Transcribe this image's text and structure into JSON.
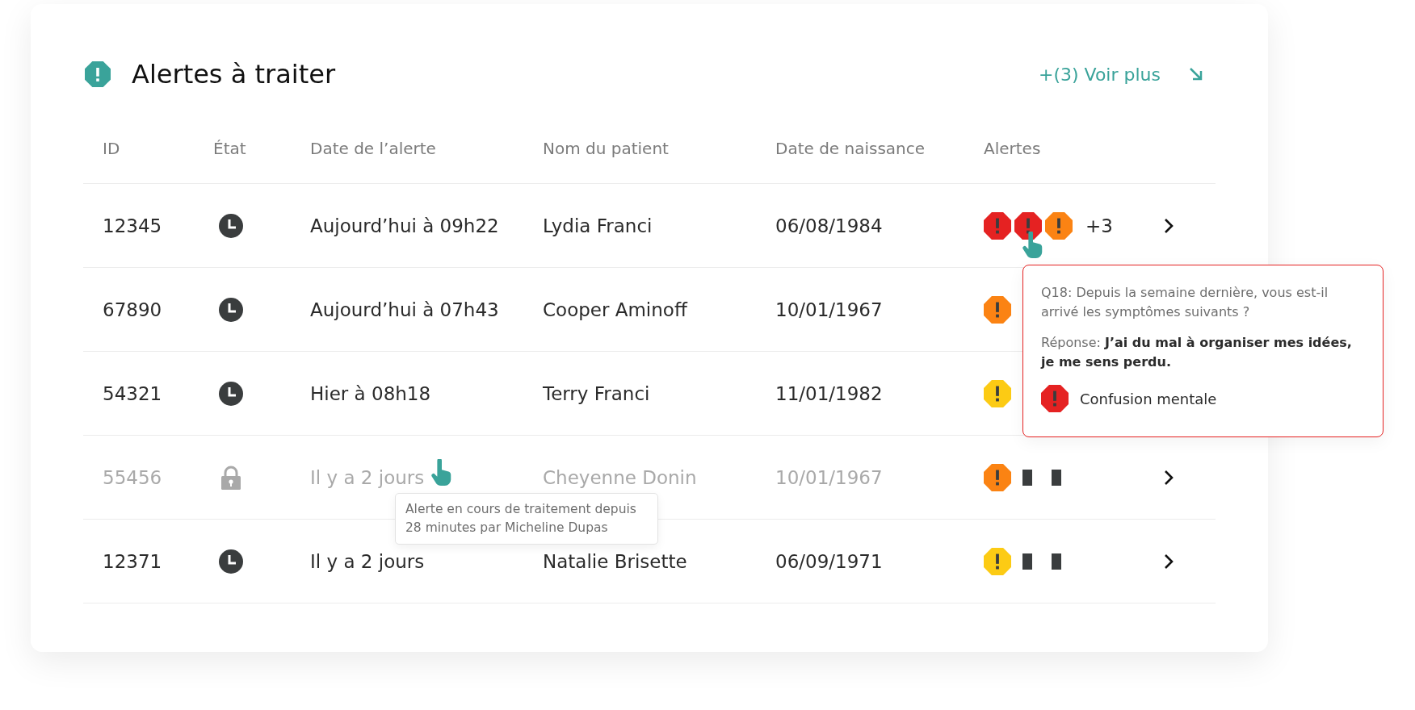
{
  "header": {
    "title": "Alertes à traiter",
    "more_link": "+(3) Voir plus"
  },
  "table": {
    "columns": [
      "ID",
      "État",
      "Date de l’alerte",
      "Nom du patient",
      "Date de naissance",
      "Alertes"
    ],
    "rows": [
      {
        "id": "12345",
        "locked": false,
        "date": "Aujourd’hui à 09h22",
        "name": "Lydia Franci",
        "birth": "06/08/1984",
        "alerts": [
          {
            "kind": "icon",
            "color": "#e52222"
          },
          {
            "kind": "icon",
            "color": "#e52222"
          },
          {
            "kind": "icon",
            "color": "#fb8313"
          }
        ],
        "more": "+3",
        "chevron": true
      },
      {
        "id": "67890",
        "locked": false,
        "date": "Aujourd’hui à 07h43",
        "name": "Cooper Aminoff",
        "birth": "10/01/1967",
        "alerts": [
          {
            "kind": "icon",
            "color": "#fb8313"
          }
        ],
        "chevron": false
      },
      {
        "id": "54321",
        "locked": false,
        "date": "Hier à 08h18",
        "name": "Terry Franci",
        "birth": "11/01/1982",
        "alerts": [
          {
            "kind": "icon",
            "color": "#fccb14"
          }
        ],
        "chevron": false
      },
      {
        "id": "55456",
        "locked": true,
        "date": "Il y a 2 jours",
        "name": "Cheyenne Donin",
        "birth": "10/01/1967",
        "alerts": [
          {
            "kind": "icon",
            "color": "#fb8313"
          },
          {
            "kind": "bar"
          },
          {
            "kind": "bar"
          }
        ],
        "chevron": true
      },
      {
        "id": "12371",
        "locked": false,
        "date": "Il y a 2 jours",
        "name": "Natalie Brisette",
        "birth": "06/09/1971",
        "alerts": [
          {
            "kind": "icon",
            "color": "#fccb14"
          },
          {
            "kind": "bar"
          },
          {
            "kind": "bar"
          }
        ],
        "chevron": true
      }
    ]
  },
  "popover": {
    "question": "Q18: Depuis la semaine dernière, vous est-il arrivé les symptômes suivants ?",
    "answer": "Réponse: **J’ai du mal à organiser mes idées, je me sens perdu.**",
    "symptom": "Confusion mentale",
    "color": "#e52222"
  },
  "tooltip": {
    "text": "Alerte en cours de traitement depuis 28 minutes par Micheline Dupas"
  }
}
